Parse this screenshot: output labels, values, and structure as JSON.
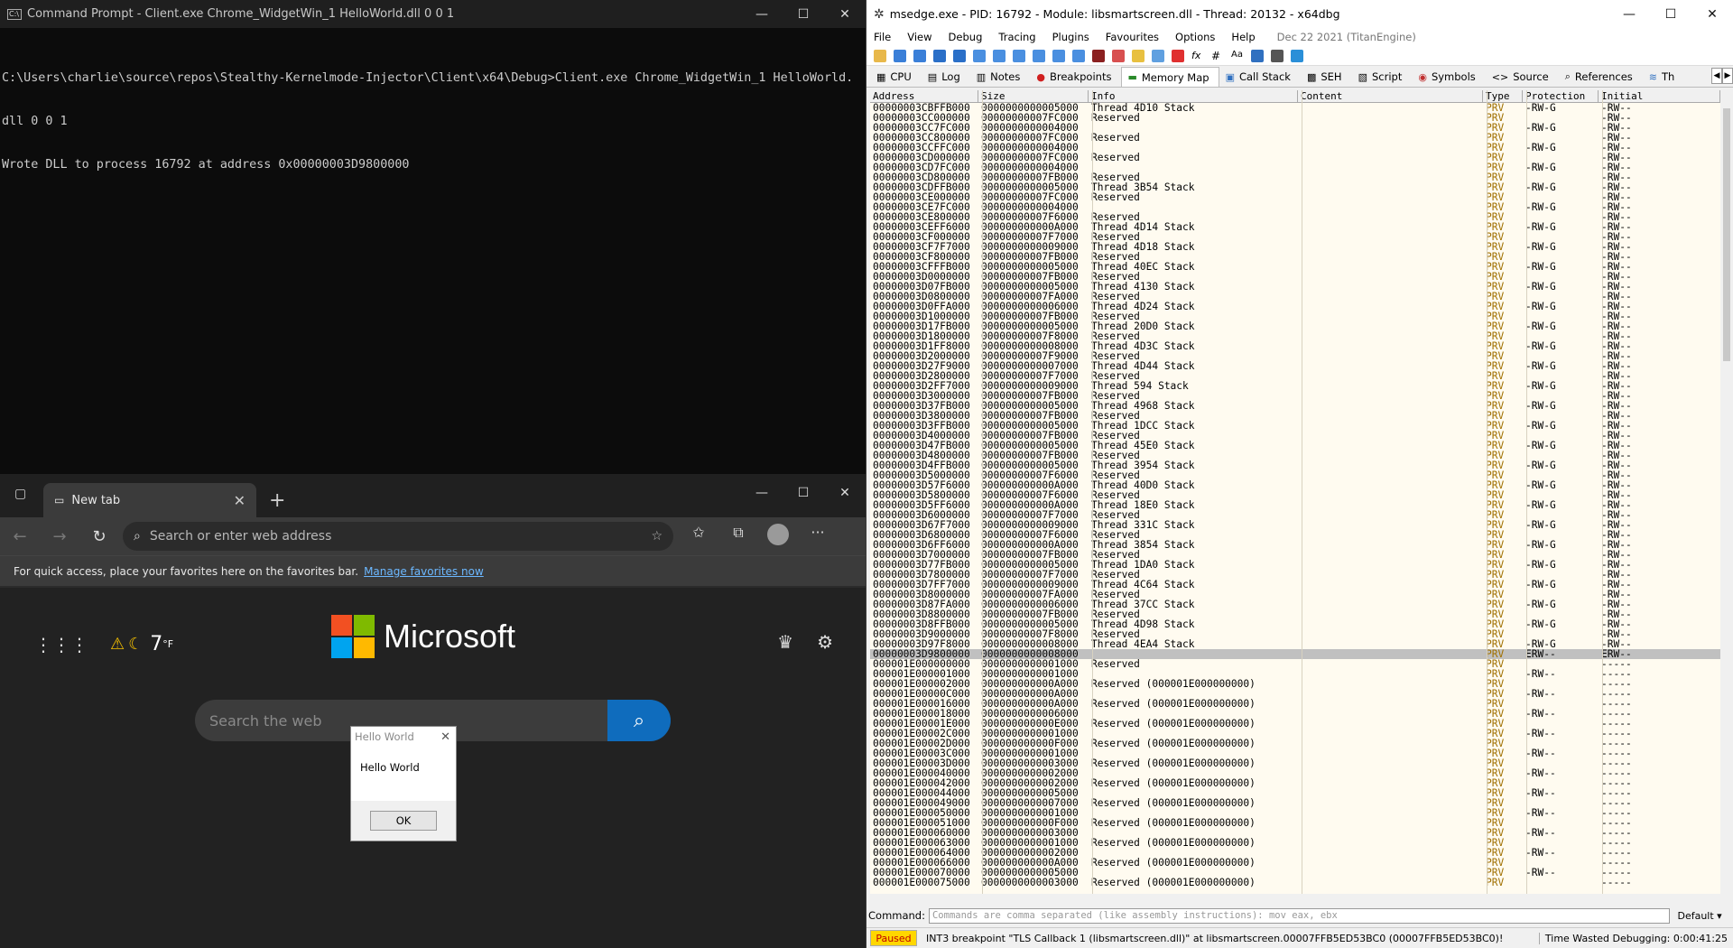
{
  "cmd": {
    "title": "Command Prompt - Client.exe  Chrome_WidgetWin_1 HelloWorld.dll 0 0 1",
    "lines": [
      "C:\\Users\\charlie\\source\\repos\\Stealthy-Kernelmode-Injector\\Client\\x64\\Debug>Client.exe Chrome_WidgetWin_1 HelloWorld.",
      "dll 0 0 1",
      "Wrote DLL to process 16792 at address 0x00000003D9800000"
    ]
  },
  "edge": {
    "tab_title": "New tab",
    "address_placeholder": "Search or enter web address",
    "favbar_text": "For quick access, place your favorites here on the favorites bar.",
    "favbar_link": "Manage favorites now",
    "temperature": "7",
    "temp_unit": "°F",
    "brand": "Microsoft",
    "search_placeholder": "Search the web",
    "logo_colors": [
      "#f25022",
      "#7fba00",
      "#00a4ef",
      "#ffb900"
    ]
  },
  "dialog": {
    "title": "Hello World",
    "message": "Hello World",
    "ok": "OK"
  },
  "dbg": {
    "title": "msedge.exe - PID: 16792 - Module: libsmartscreen.dll - Thread: 20132 - x64dbg",
    "menu": [
      "File",
      "View",
      "Debug",
      "Tracing",
      "Plugins",
      "Favourites",
      "Options",
      "Help"
    ],
    "date": "Dec 22 2021 (TitanEngine)",
    "tabs": [
      "CPU",
      "Log",
      "Notes",
      "Breakpoints",
      "Memory Map",
      "Call Stack",
      "SEH",
      "Script",
      "Symbols",
      "Source",
      "References",
      "Th"
    ],
    "columns": [
      "Address",
      "Size",
      "Info",
      "Content",
      "Type",
      "Protection",
      "Initial"
    ],
    "command_label": "Command:",
    "command_placeholder": "Commands are comma separated (like assembly instructions): mov eax, ebx",
    "default_label": "Default",
    "status_state": "Paused",
    "status_msg": "INT3 breakpoint \"TLS Callback 1 (libsmartscreen.dll)\" at libsmartscreen.00007FFB5ED53BC0 (00007FFB5ED53BC0)!",
    "status_time": "Time Wasted Debugging: 0:00:41:25",
    "rows": [
      [
        "00000003CBFFB000",
        "0000000000005000",
        "Thread 4D10 Stack",
        "",
        "PRV",
        "-RW-G",
        "-RW--"
      ],
      [
        "00000003CC000000",
        "00000000007FC000",
        "Reserved",
        "",
        "PRV",
        "",
        "-RW--"
      ],
      [
        "00000003CC7FC000",
        "0000000000004000",
        "",
        "",
        "PRV",
        "-RW-G",
        "-RW--"
      ],
      [
        "00000003CC800000",
        "00000000007FC000",
        "Reserved",
        "",
        "PRV",
        "",
        "-RW--"
      ],
      [
        "00000003CCFFC000",
        "0000000000004000",
        "",
        "",
        "PRV",
        "-RW-G",
        "-RW--"
      ],
      [
        "00000003CD000000",
        "00000000007FC000",
        "Reserved",
        "",
        "PRV",
        "",
        "-RW--"
      ],
      [
        "00000003CD7FC000",
        "0000000000004000",
        "",
        "",
        "PRV",
        "-RW-G",
        "-RW--"
      ],
      [
        "00000003CD800000",
        "00000000007FB000",
        "Reserved",
        "",
        "PRV",
        "",
        "-RW--"
      ],
      [
        "00000003CDFFB000",
        "0000000000005000",
        "Thread 3B54 Stack",
        "",
        "PRV",
        "-RW-G",
        "-RW--"
      ],
      [
        "00000003CE000000",
        "00000000007FC000",
        "Reserved",
        "",
        "PRV",
        "",
        "-RW--"
      ],
      [
        "00000003CE7FC000",
        "0000000000004000",
        "",
        "",
        "PRV",
        "-RW-G",
        "-RW--"
      ],
      [
        "00000003CE800000",
        "00000000007F6000",
        "Reserved",
        "",
        "PRV",
        "",
        "-RW--"
      ],
      [
        "00000003CEFF6000",
        "000000000000A000",
        "Thread 4D14 Stack",
        "",
        "PRV",
        "-RW-G",
        "-RW--"
      ],
      [
        "00000003CF000000",
        "00000000007F7000",
        "Reserved",
        "",
        "PRV",
        "",
        "-RW--"
      ],
      [
        "00000003CF7F7000",
        "0000000000009000",
        "Thread 4D18 Stack",
        "",
        "PRV",
        "-RW-G",
        "-RW--"
      ],
      [
        "00000003CF800000",
        "00000000007FB000",
        "Reserved",
        "",
        "PRV",
        "",
        "-RW--"
      ],
      [
        "00000003CFFFB000",
        "0000000000005000",
        "Thread 40EC Stack",
        "",
        "PRV",
        "-RW-G",
        "-RW--"
      ],
      [
        "00000003D0000000",
        "00000000007FB000",
        "Reserved",
        "",
        "PRV",
        "",
        "-RW--"
      ],
      [
        "00000003D07FB000",
        "0000000000005000",
        "Thread 4130 Stack",
        "",
        "PRV",
        "-RW-G",
        "-RW--"
      ],
      [
        "00000003D0800000",
        "00000000007FA000",
        "Reserved",
        "",
        "PRV",
        "",
        "-RW--"
      ],
      [
        "00000003D0FFA000",
        "0000000000006000",
        "Thread 4D24 Stack",
        "",
        "PRV",
        "-RW-G",
        "-RW--"
      ],
      [
        "00000003D1000000",
        "00000000007FB000",
        "Reserved",
        "",
        "PRV",
        "",
        "-RW--"
      ],
      [
        "00000003D17FB000",
        "0000000000005000",
        "Thread 20D0 Stack",
        "",
        "PRV",
        "-RW-G",
        "-RW--"
      ],
      [
        "00000003D1800000",
        "00000000007F8000",
        "Reserved",
        "",
        "PRV",
        "",
        "-RW--"
      ],
      [
        "00000003D1FF8000",
        "0000000000008000",
        "Thread 4D3C Stack",
        "",
        "PRV",
        "-RW-G",
        "-RW--"
      ],
      [
        "00000003D2000000",
        "00000000007F9000",
        "Reserved",
        "",
        "PRV",
        "",
        "-RW--"
      ],
      [
        "00000003D27F9000",
        "0000000000007000",
        "Thread 4D44 Stack",
        "",
        "PRV",
        "-RW-G",
        "-RW--"
      ],
      [
        "00000003D2800000",
        "00000000007F7000",
        "Reserved",
        "",
        "PRV",
        "",
        "-RW--"
      ],
      [
        "00000003D2FF7000",
        "0000000000009000",
        "Thread 594 Stack",
        "",
        "PRV",
        "-RW-G",
        "-RW--"
      ],
      [
        "00000003D3000000",
        "00000000007FB000",
        "Reserved",
        "",
        "PRV",
        "",
        "-RW--"
      ],
      [
        "00000003D37FB000",
        "0000000000005000",
        "Thread 4968 Stack",
        "",
        "PRV",
        "-RW-G",
        "-RW--"
      ],
      [
        "00000003D3800000",
        "00000000007FB000",
        "Reserved",
        "",
        "PRV",
        "",
        "-RW--"
      ],
      [
        "00000003D3FFB000",
        "0000000000005000",
        "Thread 1DCC Stack",
        "",
        "PRV",
        "-RW-G",
        "-RW--"
      ],
      [
        "00000003D4000000",
        "00000000007FB000",
        "Reserved",
        "",
        "PRV",
        "",
        "-RW--"
      ],
      [
        "00000003D47FB000",
        "0000000000005000",
        "Thread 45E0 Stack",
        "",
        "PRV",
        "-RW-G",
        "-RW--"
      ],
      [
        "00000003D4800000",
        "00000000007FB000",
        "Reserved",
        "",
        "PRV",
        "",
        "-RW--"
      ],
      [
        "00000003D4FFB000",
        "0000000000005000",
        "Thread 3954 Stack",
        "",
        "PRV",
        "-RW-G",
        "-RW--"
      ],
      [
        "00000003D5000000",
        "00000000007F6000",
        "Reserved",
        "",
        "PRV",
        "",
        "-RW--"
      ],
      [
        "00000003D57F6000",
        "000000000000A000",
        "Thread 40D0 Stack",
        "",
        "PRV",
        "-RW-G",
        "-RW--"
      ],
      [
        "00000003D5800000",
        "00000000007F6000",
        "Reserved",
        "",
        "PRV",
        "",
        "-RW--"
      ],
      [
        "00000003D5FF6000",
        "000000000000A000",
        "Thread 18E0 Stack",
        "",
        "PRV",
        "-RW-G",
        "-RW--"
      ],
      [
        "00000003D6000000",
        "00000000007F7000",
        "Reserved",
        "",
        "PRV",
        "",
        "-RW--"
      ],
      [
        "00000003D67F7000",
        "0000000000009000",
        "Thread 331C Stack",
        "",
        "PRV",
        "-RW-G",
        "-RW--"
      ],
      [
        "00000003D6800000",
        "00000000007F6000",
        "Reserved",
        "",
        "PRV",
        "",
        "-RW--"
      ],
      [
        "00000003D6FF6000",
        "000000000000A000",
        "Thread 3854 Stack",
        "",
        "PRV",
        "-RW-G",
        "-RW--"
      ],
      [
        "00000003D7000000",
        "00000000007FB000",
        "Reserved",
        "",
        "PRV",
        "",
        "-RW--"
      ],
      [
        "00000003D77FB000",
        "0000000000005000",
        "Thread 1DA0 Stack",
        "",
        "PRV",
        "-RW-G",
        "-RW--"
      ],
      [
        "00000003D7800000",
        "00000000007F7000",
        "Reserved",
        "",
        "PRV",
        "",
        "-RW--"
      ],
      [
        "00000003D7FF7000",
        "0000000000009000",
        "Thread 4C64 Stack",
        "",
        "PRV",
        "-RW-G",
        "-RW--"
      ],
      [
        "00000003D8000000",
        "00000000007FA000",
        "Reserved",
        "",
        "PRV",
        "",
        "-RW--"
      ],
      [
        "00000003D87FA000",
        "0000000000006000",
        "Thread 37CC Stack",
        "",
        "PRV",
        "-RW-G",
        "-RW--"
      ],
      [
        "00000003D8800000",
        "00000000007FB000",
        "Reserved",
        "",
        "PRV",
        "",
        "-RW--"
      ],
      [
        "00000003D8FFB000",
        "0000000000005000",
        "Thread 4D98 Stack",
        "",
        "PRV",
        "-RW-G",
        "-RW--"
      ],
      [
        "00000003D9000000",
        "00000000007F8000",
        "Reserved",
        "",
        "PRV",
        "",
        "-RW--"
      ],
      [
        "00000003D97F8000",
        "0000000000008000",
        "Thread 4EA4 Stack",
        "",
        "PRV",
        "-RW-G",
        "-RW--"
      ],
      [
        "00000003D9800000",
        "0000000000008000",
        "",
        "",
        "PRV",
        "ERW--",
        "ERW--"
      ],
      [
        "000001E000000000",
        "0000000000001000",
        "Reserved",
        "",
        "PRV",
        "",
        "-----"
      ],
      [
        "000001E000001000",
        "0000000000001000",
        "",
        "",
        "PRV",
        "-RW--",
        "-----"
      ],
      [
        "000001E000002000",
        "000000000000A000",
        "Reserved (000001E000000000)",
        "",
        "PRV",
        "",
        "-----"
      ],
      [
        "000001E00000C000",
        "000000000000A000",
        "",
        "",
        "PRV",
        "-RW--",
        "-----"
      ],
      [
        "000001E000016000",
        "000000000000A000",
        "Reserved (000001E000000000)",
        "",
        "PRV",
        "",
        "-----"
      ],
      [
        "000001E000018000",
        "0000000000006000",
        "",
        "",
        "PRV",
        "-RW--",
        "-----"
      ],
      [
        "000001E00001E000",
        "000000000000E000",
        "Reserved (000001E000000000)",
        "",
        "PRV",
        "",
        "-----"
      ],
      [
        "000001E00002C000",
        "0000000000001000",
        "",
        "",
        "PRV",
        "-RW--",
        "-----"
      ],
      [
        "000001E00002D000",
        "000000000000F000",
        "Reserved (000001E000000000)",
        "",
        "PRV",
        "",
        "-----"
      ],
      [
        "000001E00003C000",
        "0000000000001000",
        "",
        "",
        "PRV",
        "-RW--",
        "-----"
      ],
      [
        "000001E00003D000",
        "0000000000003000",
        "Reserved (000001E000000000)",
        "",
        "PRV",
        "",
        "-----"
      ],
      [
        "000001E000040000",
        "0000000000002000",
        "",
        "",
        "PRV",
        "-RW--",
        "-----"
      ],
      [
        "000001E000042000",
        "0000000000002000",
        "Reserved (000001E000000000)",
        "",
        "PRV",
        "",
        "-----"
      ],
      [
        "000001E000044000",
        "0000000000005000",
        "",
        "",
        "PRV",
        "-RW--",
        "-----"
      ],
      [
        "000001E000049000",
        "0000000000007000",
        "Reserved (000001E000000000)",
        "",
        "PRV",
        "",
        "-----"
      ],
      [
        "000001E000050000",
        "0000000000001000",
        "",
        "",
        "PRV",
        "-RW--",
        "-----"
      ],
      [
        "000001E000051000",
        "000000000000F000",
        "Reserved (000001E000000000)",
        "",
        "PRV",
        "",
        "-----"
      ],
      [
        "000001E000060000",
        "0000000000003000",
        "",
        "",
        "PRV",
        "-RW--",
        "-----"
      ],
      [
        "000001E000063000",
        "0000000000001000",
        "Reserved (000001E000000000)",
        "",
        "PRV",
        "",
        "-----"
      ],
      [
        "000001E000064000",
        "0000000000002000",
        "",
        "",
        "PRV",
        "-RW--",
        "-----"
      ],
      [
        "000001E000066000",
        "000000000000A000",
        "Reserved (000001E000000000)",
        "",
        "PRV",
        "",
        "-----"
      ],
      [
        "000001E000070000",
        "0000000000005000",
        "",
        "",
        "PRV",
        "-RW--",
        "-----"
      ],
      [
        "000001E000075000",
        "0000000000003000",
        "Reserved (000001E000000000)",
        "",
        "PRV",
        "",
        "-----"
      ]
    ]
  }
}
